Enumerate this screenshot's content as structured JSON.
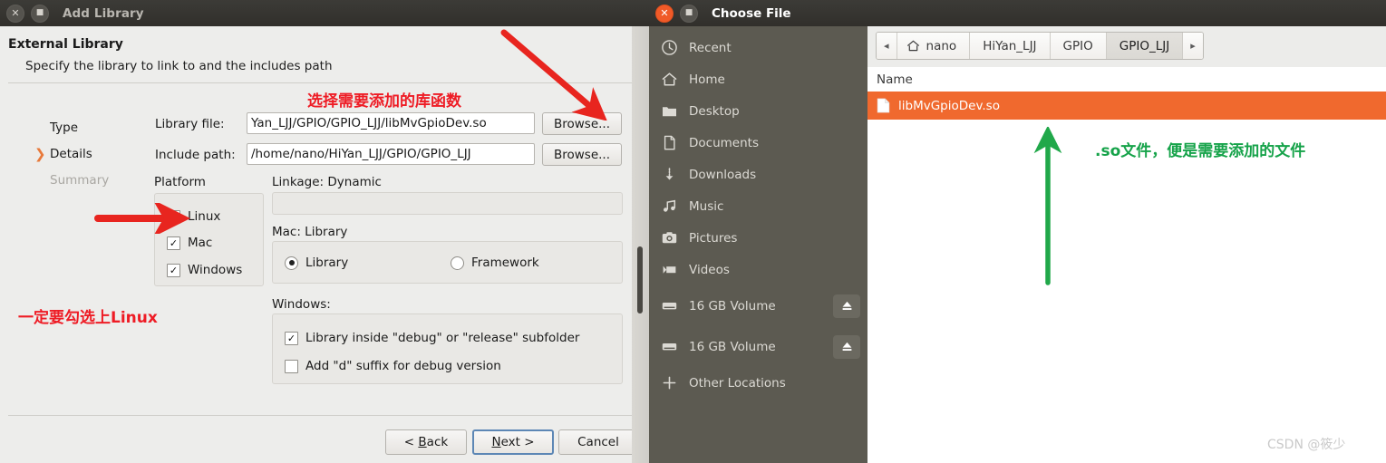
{
  "add_library": {
    "window_title": "Add Library",
    "titlebar_buttons": {
      "close": "close-button",
      "maximize": "maximize-button"
    },
    "header": {
      "title": "External Library",
      "subtitle": "Specify the library to link to and the includes path"
    },
    "steps": [
      {
        "label": "Type",
        "active": false,
        "dim": false
      },
      {
        "label": "Details",
        "active": true,
        "dim": false
      },
      {
        "label": "Summary",
        "active": false,
        "dim": true
      }
    ],
    "fields": {
      "library_file_label": "Library file:",
      "library_file_value": "Yan_LJJ/GPIO/GPIO_LJJ/libMvGpioDev.so",
      "library_file_browse": "Browse...",
      "include_path_label": "Include path:",
      "include_path_value": "/home/nano/HiYan_LJJ/GPIO/GPIO_LJJ",
      "include_path_browse": "Browse..."
    },
    "platform": {
      "label": "Platform",
      "options": [
        {
          "label": "Linux",
          "checked": true
        },
        {
          "label": "Mac",
          "checked": true
        },
        {
          "label": "Windows",
          "checked": true
        }
      ]
    },
    "linkage": {
      "label": "Linkage: Dynamic",
      "value": ""
    },
    "mac_library": {
      "label": "Mac: Library",
      "options": [
        {
          "label": "Library",
          "selected": true
        },
        {
          "label": "Framework",
          "selected": false
        }
      ]
    },
    "windows": {
      "label": "Windows:",
      "options": [
        {
          "label": "Library inside \"debug\" or \"release\" subfolder",
          "checked": true
        },
        {
          "label": "Add \"d\" suffix for debug version",
          "checked": false
        }
      ]
    },
    "buttons": {
      "back": "< Back",
      "back_accel": "B",
      "next": "Next >",
      "next_accel": "N",
      "cancel": "Cancel"
    }
  },
  "choose_file": {
    "window_title": "Choose File",
    "sidebar": [
      {
        "label": "Recent",
        "icon": "clock-icon",
        "eject": false
      },
      {
        "label": "Home",
        "icon": "home-icon",
        "eject": false
      },
      {
        "label": "Desktop",
        "icon": "folder-icon",
        "eject": false
      },
      {
        "label": "Documents",
        "icon": "document-icon",
        "eject": false
      },
      {
        "label": "Downloads",
        "icon": "download-icon",
        "eject": false
      },
      {
        "label": "Music",
        "icon": "music-icon",
        "eject": false
      },
      {
        "label": "Pictures",
        "icon": "camera-icon",
        "eject": false
      },
      {
        "label": "Videos",
        "icon": "video-icon",
        "eject": false
      },
      {
        "label": "16 GB Volume",
        "icon": "drive-icon",
        "eject": true
      },
      {
        "label": "16 GB Volume",
        "icon": "drive-icon",
        "eject": true
      },
      {
        "label": "Other Locations",
        "icon": "plus-icon",
        "eject": false
      }
    ],
    "breadcrumbs": [
      {
        "label": "◂",
        "type": "arrow-left",
        "active": false
      },
      {
        "label": "nano",
        "type": "home",
        "active": false
      },
      {
        "label": "HiYan_LJJ",
        "type": "crumb",
        "active": false
      },
      {
        "label": "GPIO",
        "type": "crumb",
        "active": false
      },
      {
        "label": "GPIO_LJJ",
        "type": "crumb",
        "active": true
      },
      {
        "label": "▸",
        "type": "arrow-right",
        "active": false
      }
    ],
    "column_headers": [
      "Name"
    ],
    "files": [
      {
        "name": "libMvGpioDev.so",
        "selected": true,
        "icon": "file-icon"
      }
    ]
  },
  "annotations": {
    "red_top": "选择需要添加的库函数",
    "red_left": "一定要勾选上Linux",
    "green_right": ".so文件，便是需要添加的文件",
    "watermark": "CSDN @筱少"
  },
  "colors": {
    "accent_orange": "#f0692e",
    "annotation_red": "#ee1c25",
    "annotation_green": "#16a34a",
    "titlebar": "#35332f",
    "sidebar": "#5c5a51",
    "step_chevron": "#e8793a"
  }
}
